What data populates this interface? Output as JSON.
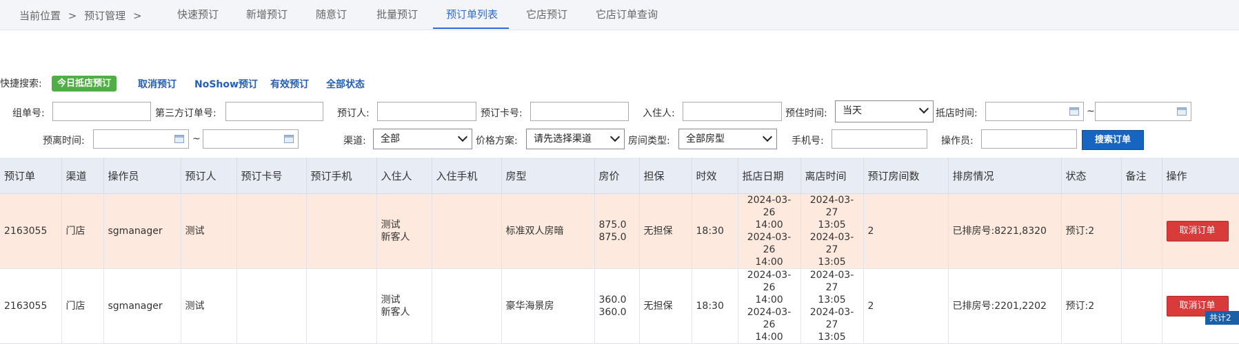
{
  "breadcrumb": {
    "prefix": "当前位置",
    "sep1": ">",
    "item": "预订管理",
    "sep2": ">"
  },
  "tabs": [
    "快速预订",
    "新增预订",
    "随意订",
    "批量预订",
    "预订单列表",
    "它店预订",
    "它店订单查询"
  ],
  "active_tab": "预订单列表",
  "quick_search": {
    "label": "快捷搜索:",
    "active": "今日抵店预订",
    "links": [
      "取消预订",
      "NoShow预订",
      "有效预订",
      "全部状态"
    ]
  },
  "form": {
    "group_no_label": "组单号:",
    "third_party_label": "第三方订单号:",
    "booker_label": "预订人:",
    "card_label": "预订卡号:",
    "guest_label": "入住人:",
    "checkin_time_label": "预住时间:",
    "checkin_time_value": "当天",
    "arrival_label": "抵店时间:",
    "tilde": "~",
    "departure_label": "预离时间:",
    "channel_label": "渠道:",
    "channel_value": "全部",
    "price_label": "价格方案:",
    "price_value": "请先选择渠道",
    "room_type_label": "房间类型:",
    "room_type_value": "全部房型",
    "phone_label": "手机号:",
    "operator_label": "操作员:",
    "search_button": "搜索订单"
  },
  "table": {
    "headers": [
      "预订单",
      "渠道",
      "操作员",
      "预订人",
      "预订卡号",
      "预订手机",
      "入住人",
      "入住手机",
      "房型",
      "房价",
      "担保",
      "时效",
      "抵店日期",
      "离店时间",
      "预订房间数",
      "排房情况",
      "状态",
      "备注",
      "操作"
    ],
    "rows": [
      {
        "order": "2163055",
        "channel": "门店",
        "operator": "sgmanager",
        "booker": "测试",
        "card": "",
        "phone": "",
        "guest1": "测试",
        "guest2": "新客人",
        "guest_phone": "",
        "room_type": "标准双人房暗",
        "price1": "875.0",
        "price2": "875.0",
        "guarantee": "无担保",
        "validity": "18:30",
        "arr1_date": "2024-03-26",
        "arr1_time": "14:00",
        "arr2_date": "2024-03-26",
        "arr2_time": "14:00",
        "dep1_date": "2024-03-27",
        "dep1_time": "13:05",
        "dep2_date": "2024-03-27",
        "dep2_time": "13:05",
        "rooms": "2",
        "assign": "已排房号:8221,8320",
        "status": "预订:2",
        "remark": "",
        "action": "取消订单"
      },
      {
        "order": "2163055",
        "channel": "门店",
        "operator": "sgmanager",
        "booker": "测试",
        "card": "",
        "phone": "",
        "guest1": "测试",
        "guest2": "新客人",
        "guest_phone": "",
        "room_type": "豪华海景房",
        "price1": "360.0",
        "price2": "360.0",
        "guarantee": "无担保",
        "validity": "18:30",
        "arr1_date": "2024-03-26",
        "arr1_time": "14:00",
        "arr2_date": "2024-03-26",
        "arr2_time": "14:00",
        "dep1_date": "2024-03-27",
        "dep1_time": "13:05",
        "dep2_date": "2024-03-27",
        "dep2_time": "13:05",
        "rooms": "2",
        "assign": "已排房号:2201,2202",
        "status": "预订:2",
        "remark": "",
        "action": "取消订单"
      }
    ]
  },
  "footer": {
    "total": "共计2"
  }
}
